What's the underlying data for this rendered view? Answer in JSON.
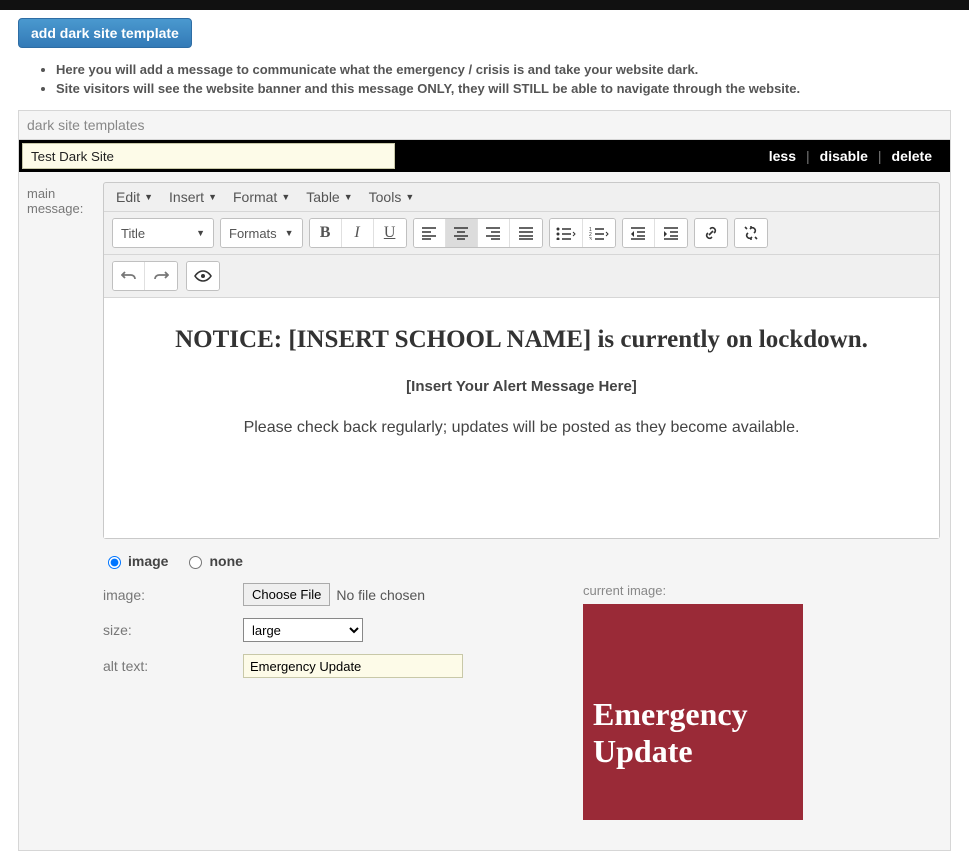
{
  "buttons": {
    "add_template": "add dark site template",
    "choose_file": "Choose File"
  },
  "help": [
    "Here you will add a message to communicate what the emergency / crisis is and take your website dark.",
    "Site visitors will see the website banner and this message ONLY, they will STILL be able to navigate through the website."
  ],
  "panel_title": "dark site templates",
  "template_name": "Test Dark Site",
  "actions": {
    "less": "less",
    "disable": "disable",
    "delete": "delete"
  },
  "labels": {
    "main_message": "main message:",
    "image": "image:",
    "size": "size:",
    "alt_text": "alt text:",
    "current_image": "current image:"
  },
  "editor": {
    "menubar": {
      "edit": "Edit",
      "insert": "Insert",
      "format": "Format",
      "table": "Table",
      "tools": "Tools"
    },
    "selects": {
      "title": "Title",
      "formats": "Formats"
    },
    "content": {
      "heading": "NOTICE: [INSERT SCHOOL NAME] is currently on lockdown.",
      "line1": "[Insert Your Alert Message Here]",
      "line2": "Please check back regularly; updates will be posted as they become available."
    }
  },
  "radio": {
    "image": "image",
    "none": "none"
  },
  "file_status": "No file chosen",
  "size_value": "large",
  "alt_value": "Emergency Update",
  "preview_text": "Emergency Update"
}
